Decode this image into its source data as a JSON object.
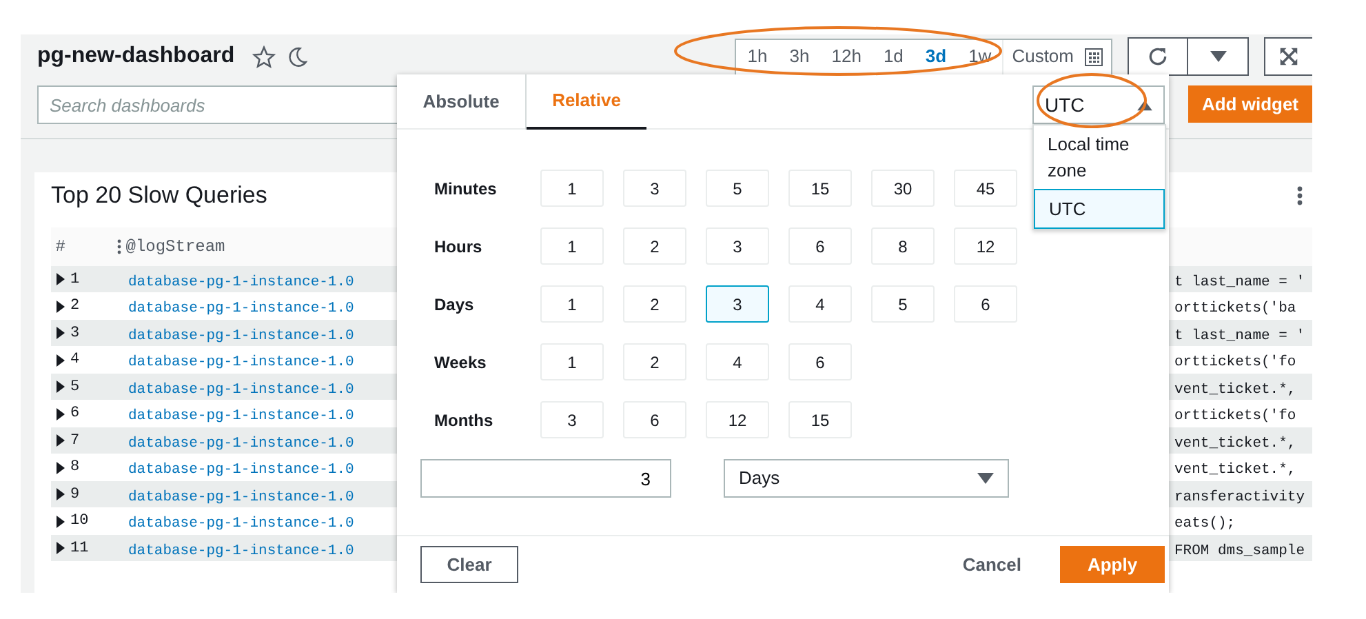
{
  "dashboard": {
    "title": "pg-new-dashboard",
    "search": {
      "placeholder": "Search dashboards"
    }
  },
  "time_range": {
    "options": [
      {
        "label": "1h",
        "selected": false
      },
      {
        "label": "3h",
        "selected": false
      },
      {
        "label": "12h",
        "selected": false
      },
      {
        "label": "1d",
        "selected": false
      },
      {
        "label": "3d",
        "selected": true
      },
      {
        "label": "1w",
        "selected": false
      }
    ],
    "custom": "Custom"
  },
  "actions": {
    "add_widget": "Add widget"
  },
  "widget": {
    "title": "Top 20 Slow Queries",
    "columns": [
      "#",
      "@logStream"
    ],
    "rows": [
      {
        "index": "1",
        "log_stream": "database-pg-1-instance-1.0",
        "column_3": "t last_name = '"
      },
      {
        "index": "2",
        "log_stream": "database-pg-1-instance-1.0",
        "column_3": "orttickets('ba"
      },
      {
        "index": "3",
        "log_stream": "database-pg-1-instance-1.0",
        "column_3": "t last_name = '"
      },
      {
        "index": "4",
        "log_stream": "database-pg-1-instance-1.0",
        "column_3": "orttickets('fo"
      },
      {
        "index": "5",
        "log_stream": "database-pg-1-instance-1.0",
        "column_3": "vent_ticket.*,"
      },
      {
        "index": "6",
        "log_stream": "database-pg-1-instance-1.0",
        "column_3": "orttickets('fo"
      },
      {
        "index": "7",
        "log_stream": "database-pg-1-instance-1.0",
        "column_3": "vent_ticket.*,"
      },
      {
        "index": "8",
        "log_stream": "database-pg-1-instance-1.0",
        "column_3": "vent_ticket.*,"
      },
      {
        "index": "9",
        "log_stream": "database-pg-1-instance-1.0",
        "column_3": "ransferactivity"
      },
      {
        "index": "10",
        "log_stream": "database-pg-1-instance-1.0",
        "column_3": "eats();"
      },
      {
        "index": "11",
        "log_stream": "database-pg-1-instance-1.0",
        "column_3": "FROM dms_sample"
      }
    ]
  },
  "time_picker": {
    "tabs": [
      {
        "label": "Absolute",
        "selected": false
      },
      {
        "label": "Relative",
        "selected": true
      }
    ],
    "timezone": {
      "value": "UTC",
      "options": [
        {
          "label": "Local time zone",
          "selected": false
        },
        {
          "label": "UTC",
          "selected": true
        }
      ]
    },
    "units": [
      {
        "label": "Minutes",
        "values": [
          {
            "label": "1",
            "selected": false
          },
          {
            "label": "3",
            "selected": false
          },
          {
            "label": "5",
            "selected": false
          },
          {
            "label": "15",
            "selected": false
          },
          {
            "label": "30",
            "selected": false
          },
          {
            "label": "45",
            "selected": false
          }
        ]
      },
      {
        "label": "Hours",
        "values": [
          {
            "label": "1",
            "selected": false
          },
          {
            "label": "2",
            "selected": false
          },
          {
            "label": "3",
            "selected": false
          },
          {
            "label": "6",
            "selected": false
          },
          {
            "label": "8",
            "selected": false
          },
          {
            "label": "12",
            "selected": false
          }
        ]
      },
      {
        "label": "Days",
        "values": [
          {
            "label": "1",
            "selected": false
          },
          {
            "label": "2",
            "selected": false
          },
          {
            "label": "3",
            "selected": true
          },
          {
            "label": "4",
            "selected": false
          },
          {
            "label": "5",
            "selected": false
          },
          {
            "label": "6",
            "selected": false
          }
        ]
      },
      {
        "label": "Weeks",
        "values": [
          {
            "label": "1",
            "selected": false
          },
          {
            "label": "2",
            "selected": false
          },
          {
            "label": "4",
            "selected": false
          },
          {
            "label": "6",
            "selected": false
          }
        ]
      },
      {
        "label": "Months",
        "values": [
          {
            "label": "3",
            "selected": false
          },
          {
            "label": "6",
            "selected": false
          },
          {
            "label": "12",
            "selected": false
          },
          {
            "label": "15",
            "selected": false
          }
        ]
      }
    ],
    "custom_value": "3",
    "custom_unit": "Days",
    "buttons": {
      "clear": "Clear",
      "cancel": "Cancel",
      "apply": "Apply"
    }
  }
}
